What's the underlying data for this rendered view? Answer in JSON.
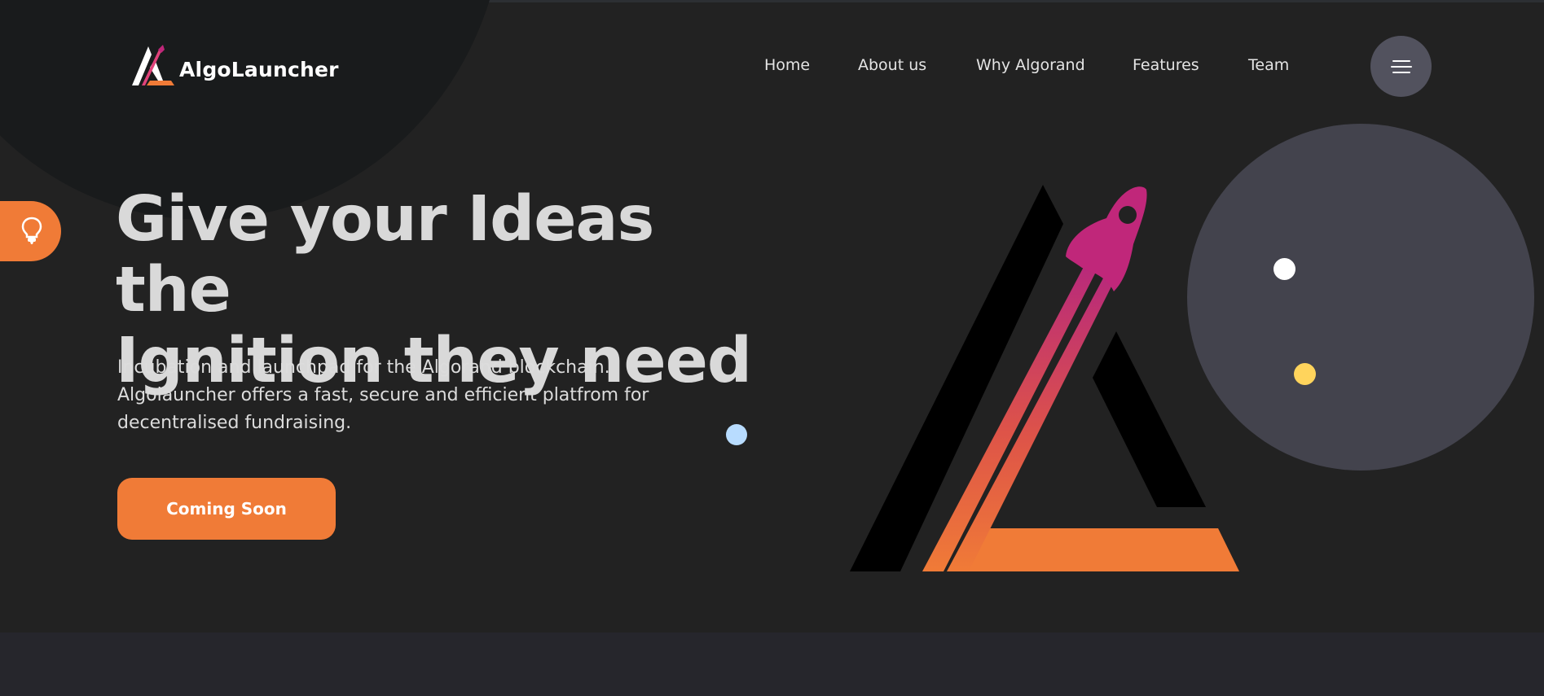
{
  "brand": {
    "name": "AlgoLauncher"
  },
  "nav": {
    "items": [
      {
        "label": "Home"
      },
      {
        "label": "About us"
      },
      {
        "label": "Why Algorand"
      },
      {
        "label": "Features"
      },
      {
        "label": "Team"
      }
    ],
    "menu_icon": "hamburger-menu-icon"
  },
  "side_tab": {
    "icon": "lightbulb-icon"
  },
  "hero": {
    "title_line1": "Give your Ideas the",
    "title_line2": "Ignition they need",
    "subtitle_line1": "Incubation and launchpad for the Algorand blockchain.",
    "subtitle_line2": "Algolauncher offers a fast, secure and efficient platfrom for",
    "subtitle_line3": "decentralised fundraising.",
    "cta_label": "Coming Soon",
    "illustration": "rocket-triangle-logo-illustration"
  },
  "colors": {
    "background": "#222222",
    "accent_orange": "#f07b37",
    "accent_magenta": "#c0277a",
    "circle_grey": "#43434d",
    "dot_blue": "#b8dcff",
    "dot_yellow": "#ffd45c"
  }
}
